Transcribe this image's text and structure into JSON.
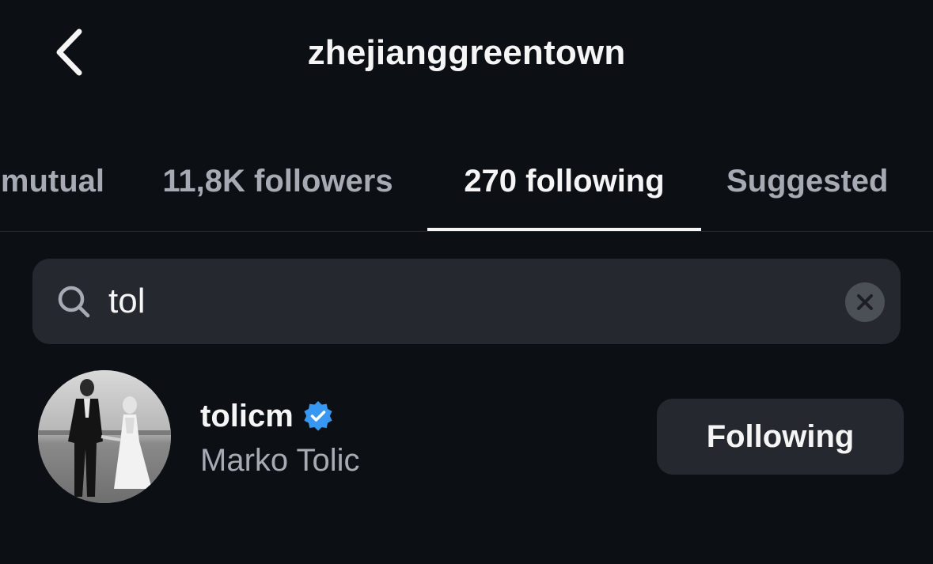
{
  "header": {
    "title": "zhejianggreentown",
    "back_icon": "chevron-left-icon"
  },
  "tabs": [
    {
      "label": "mutual",
      "active": false
    },
    {
      "label": "11,8K followers",
      "active": false
    },
    {
      "label": "270 following",
      "active": true
    },
    {
      "label": "Suggested",
      "active": false
    }
  ],
  "search": {
    "value": "tol",
    "icon": "search-icon",
    "clear_icon": "close-icon"
  },
  "results": [
    {
      "username": "tolicm",
      "verified": true,
      "full_name": "Marko Tolic",
      "button_label": "Following"
    }
  ],
  "colors": {
    "background": "#0c0f14",
    "surface": "#25282e",
    "text_primary": "#f5f5f5",
    "text_secondary": "#a6abb3",
    "verified_blue": "#3897f0"
  }
}
